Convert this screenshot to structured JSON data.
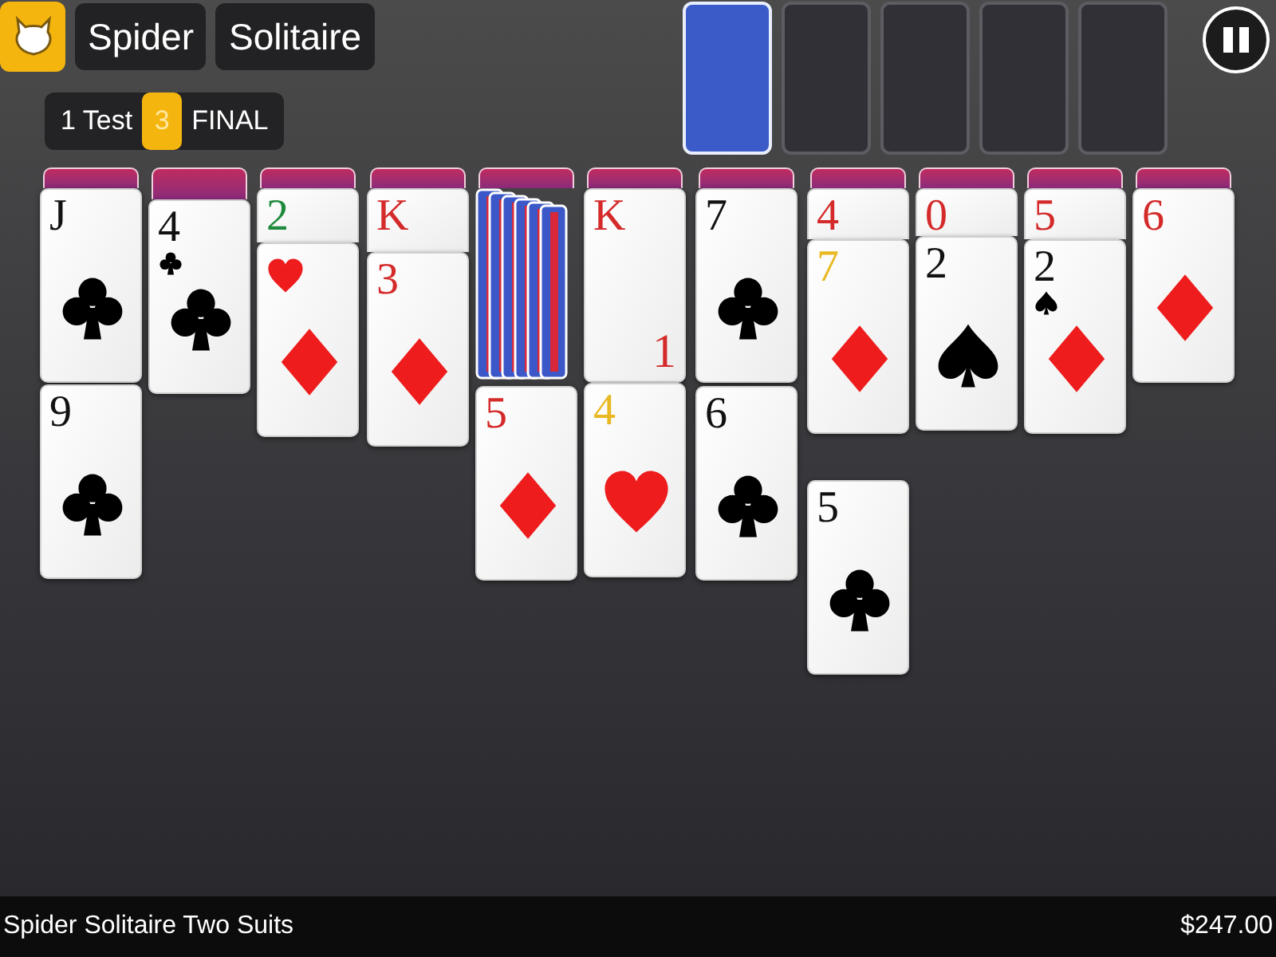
{
  "header": {
    "title_words": [
      "Spider",
      "Solitaire"
    ],
    "subtitle": {
      "before": "1 Test",
      "badge": "3",
      "after": "FINAL"
    }
  },
  "foundations": [
    {
      "filled": true
    },
    {
      "filled": false
    },
    {
      "filled": false
    },
    {
      "filled": false
    },
    {
      "filled": false
    }
  ],
  "tableau": [
    {
      "cards": [
        {
          "face_up": true,
          "rank": "J",
          "color": "#111111"
        },
        {
          "face_up": true,
          "rank": "9",
          "color": "#111111"
        }
      ]
    },
    {
      "cards": [
        {
          "face_up": true,
          "rank": "4",
          "color": "#111111"
        }
      ]
    },
    {
      "cards": [
        {
          "face_up": true,
          "rank": "2",
          "color": "#1f8a3c"
        },
        {
          "face_up": true
        }
      ]
    },
    {
      "cards": [
        {
          "face_up": true,
          "rank": "K",
          "color": "#d42a2a"
        },
        {
          "face_up": true,
          "rank": "3",
          "color": "#d42a2a"
        }
      ]
    },
    {
      "stock_fan": true,
      "cards": [
        {
          "face_up": true,
          "rank": "5",
          "color": "#d42a2a"
        }
      ]
    },
    {
      "cards": [
        {
          "face_up": true,
          "rank": "K",
          "color": "#d42a2a",
          "corner": "1"
        },
        {
          "face_up": true,
          "rank": "4",
          "color": "#e8b923"
        }
      ]
    },
    {
      "cards": [
        {
          "face_up": true,
          "rank": "7",
          "color": "#111111"
        },
        {
          "face_up": true,
          "rank": "6",
          "color": "#111111"
        }
      ]
    },
    {
      "cards": [
        {
          "face_up": true,
          "rank": "4",
          "color": "#d42a2a"
        },
        {
          "face_up": true,
          "rank": "7",
          "color": "#e8b923"
        },
        {
          "face_up": true,
          "rank": "5",
          "color": "#111111"
        }
      ]
    },
    {
      "cards": [
        {
          "face_up": true,
          "rank": "0",
          "color": "#d42a2a"
        },
        {
          "face_up": true,
          "rank": "2",
          "color": "#111111"
        }
      ]
    },
    {
      "cards": [
        {
          "face_up": true,
          "rank": "5",
          "color": "#d42a2a"
        },
        {
          "face_up": true,
          "rank": "2",
          "color": "#111111"
        }
      ]
    },
    {
      "cards": [
        {
          "face_up": true,
          "rank": "6",
          "color": "#d42a2a"
        }
      ]
    }
  ],
  "status_bar": {
    "left": "Spider Solitaire Two Suits",
    "right": "$247.00"
  }
}
